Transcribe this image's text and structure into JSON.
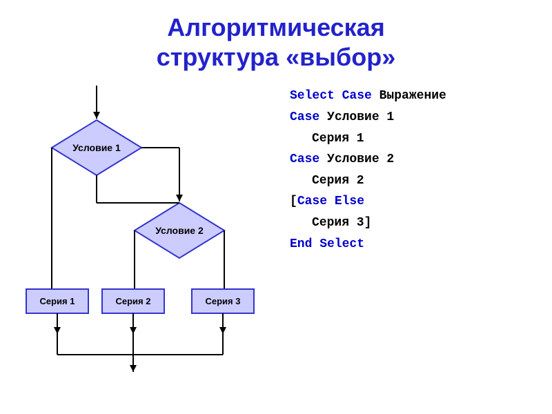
{
  "title": {
    "line1": "Алгоритмическая",
    "line2": "структура «выбор»"
  },
  "flowchart": {
    "diamond1_label": "Условие 1",
    "diamond2_label": "Условие 2",
    "box1_label": "Серия 1",
    "box2_label": "Серия 2",
    "box3_label": "Серия 3"
  },
  "code": {
    "line1_kw": "Select Case",
    "line1_plain": " Выражение",
    "line2_kw": "Case",
    "line2_plain": " Условие 1",
    "line3_indent": "Серия 1",
    "line4_kw": "Case",
    "line4_plain": " Условие 2",
    "line5_indent": "Серия 2",
    "line6_bracket": "[",
    "line6_kw": "Case Else",
    "line7_indent": "Серия 3]",
    "line8_kw": "End Select"
  }
}
